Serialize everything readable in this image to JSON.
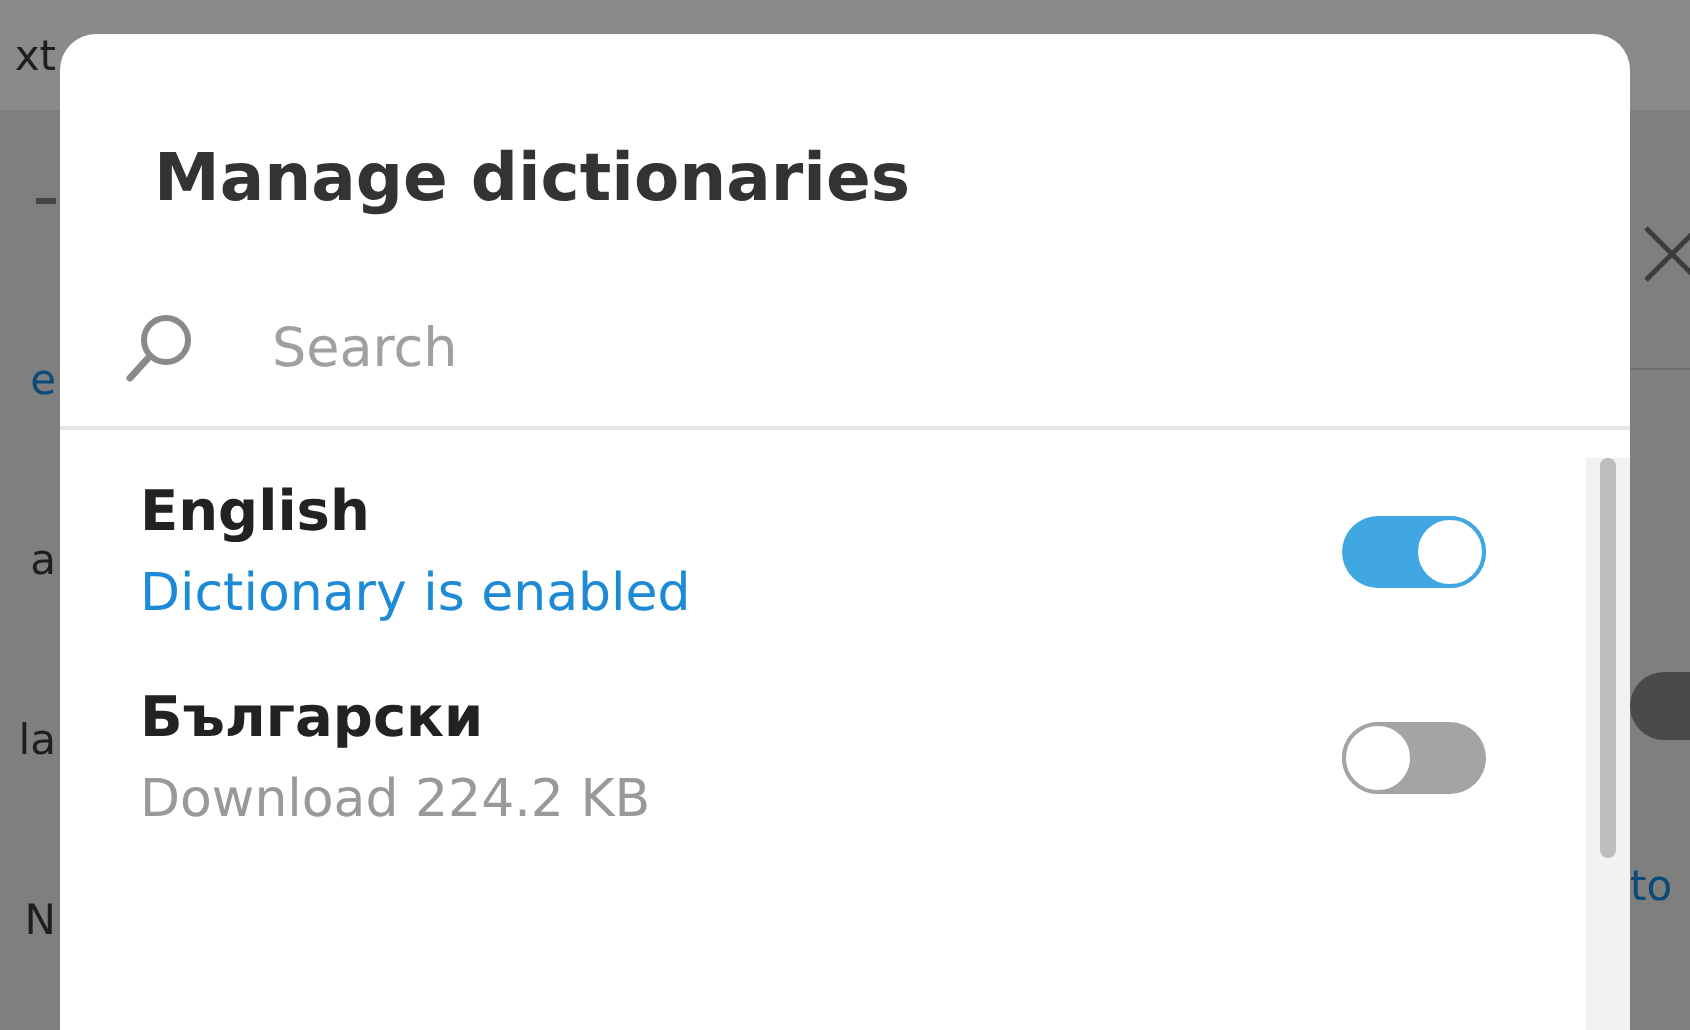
{
  "background": {
    "left_fragments": [
      {
        "kind": "text",
        "text": "xt"
      },
      {
        "kind": "rule"
      },
      {
        "kind": "link",
        "text": "e"
      },
      {
        "kind": "text",
        "text": "a"
      },
      {
        "kind": "text",
        "text": "la"
      },
      {
        "kind": "text",
        "text": "N"
      }
    ],
    "right_fragments": [
      {
        "kind": "close"
      },
      {
        "kind": "toggle",
        "on": false
      },
      {
        "kind": "link",
        "text": "to"
      }
    ]
  },
  "dialog": {
    "title": "Manage dictionaries",
    "search": {
      "placeholder": "Search"
    },
    "dictionaries": [
      {
        "name": "English",
        "status": "Dictionary is enabled",
        "enabled": true
      },
      {
        "name": "Български",
        "status": "Download 224.2 KB",
        "enabled": false
      }
    ]
  }
}
